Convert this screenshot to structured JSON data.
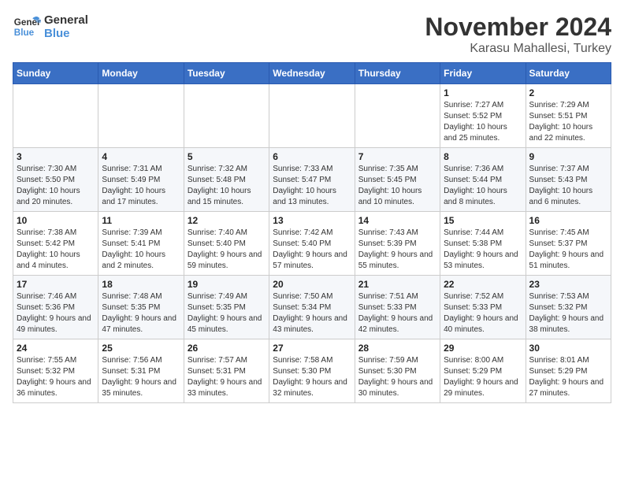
{
  "logo": {
    "line1": "General",
    "line2": "Blue"
  },
  "header": {
    "month": "November 2024",
    "location": "Karasu Mahallesi, Turkey"
  },
  "weekdays": [
    "Sunday",
    "Monday",
    "Tuesday",
    "Wednesday",
    "Thursday",
    "Friday",
    "Saturday"
  ],
  "weeks": [
    [
      {
        "day": "",
        "info": ""
      },
      {
        "day": "",
        "info": ""
      },
      {
        "day": "",
        "info": ""
      },
      {
        "day": "",
        "info": ""
      },
      {
        "day": "",
        "info": ""
      },
      {
        "day": "1",
        "info": "Sunrise: 7:27 AM\nSunset: 5:52 PM\nDaylight: 10 hours and 25 minutes."
      },
      {
        "day": "2",
        "info": "Sunrise: 7:29 AM\nSunset: 5:51 PM\nDaylight: 10 hours and 22 minutes."
      }
    ],
    [
      {
        "day": "3",
        "info": "Sunrise: 7:30 AM\nSunset: 5:50 PM\nDaylight: 10 hours and 20 minutes."
      },
      {
        "day": "4",
        "info": "Sunrise: 7:31 AM\nSunset: 5:49 PM\nDaylight: 10 hours and 17 minutes."
      },
      {
        "day": "5",
        "info": "Sunrise: 7:32 AM\nSunset: 5:48 PM\nDaylight: 10 hours and 15 minutes."
      },
      {
        "day": "6",
        "info": "Sunrise: 7:33 AM\nSunset: 5:47 PM\nDaylight: 10 hours and 13 minutes."
      },
      {
        "day": "7",
        "info": "Sunrise: 7:35 AM\nSunset: 5:45 PM\nDaylight: 10 hours and 10 minutes."
      },
      {
        "day": "8",
        "info": "Sunrise: 7:36 AM\nSunset: 5:44 PM\nDaylight: 10 hours and 8 minutes."
      },
      {
        "day": "9",
        "info": "Sunrise: 7:37 AM\nSunset: 5:43 PM\nDaylight: 10 hours and 6 minutes."
      }
    ],
    [
      {
        "day": "10",
        "info": "Sunrise: 7:38 AM\nSunset: 5:42 PM\nDaylight: 10 hours and 4 minutes."
      },
      {
        "day": "11",
        "info": "Sunrise: 7:39 AM\nSunset: 5:41 PM\nDaylight: 10 hours and 2 minutes."
      },
      {
        "day": "12",
        "info": "Sunrise: 7:40 AM\nSunset: 5:40 PM\nDaylight: 9 hours and 59 minutes."
      },
      {
        "day": "13",
        "info": "Sunrise: 7:42 AM\nSunset: 5:40 PM\nDaylight: 9 hours and 57 minutes."
      },
      {
        "day": "14",
        "info": "Sunrise: 7:43 AM\nSunset: 5:39 PM\nDaylight: 9 hours and 55 minutes."
      },
      {
        "day": "15",
        "info": "Sunrise: 7:44 AM\nSunset: 5:38 PM\nDaylight: 9 hours and 53 minutes."
      },
      {
        "day": "16",
        "info": "Sunrise: 7:45 AM\nSunset: 5:37 PM\nDaylight: 9 hours and 51 minutes."
      }
    ],
    [
      {
        "day": "17",
        "info": "Sunrise: 7:46 AM\nSunset: 5:36 PM\nDaylight: 9 hours and 49 minutes."
      },
      {
        "day": "18",
        "info": "Sunrise: 7:48 AM\nSunset: 5:35 PM\nDaylight: 9 hours and 47 minutes."
      },
      {
        "day": "19",
        "info": "Sunrise: 7:49 AM\nSunset: 5:35 PM\nDaylight: 9 hours and 45 minutes."
      },
      {
        "day": "20",
        "info": "Sunrise: 7:50 AM\nSunset: 5:34 PM\nDaylight: 9 hours and 43 minutes."
      },
      {
        "day": "21",
        "info": "Sunrise: 7:51 AM\nSunset: 5:33 PM\nDaylight: 9 hours and 42 minutes."
      },
      {
        "day": "22",
        "info": "Sunrise: 7:52 AM\nSunset: 5:33 PM\nDaylight: 9 hours and 40 minutes."
      },
      {
        "day": "23",
        "info": "Sunrise: 7:53 AM\nSunset: 5:32 PM\nDaylight: 9 hours and 38 minutes."
      }
    ],
    [
      {
        "day": "24",
        "info": "Sunrise: 7:55 AM\nSunset: 5:32 PM\nDaylight: 9 hours and 36 minutes."
      },
      {
        "day": "25",
        "info": "Sunrise: 7:56 AM\nSunset: 5:31 PM\nDaylight: 9 hours and 35 minutes."
      },
      {
        "day": "26",
        "info": "Sunrise: 7:57 AM\nSunset: 5:31 PM\nDaylight: 9 hours and 33 minutes."
      },
      {
        "day": "27",
        "info": "Sunrise: 7:58 AM\nSunset: 5:30 PM\nDaylight: 9 hours and 32 minutes."
      },
      {
        "day": "28",
        "info": "Sunrise: 7:59 AM\nSunset: 5:30 PM\nDaylight: 9 hours and 30 minutes."
      },
      {
        "day": "29",
        "info": "Sunrise: 8:00 AM\nSunset: 5:29 PM\nDaylight: 9 hours and 29 minutes."
      },
      {
        "day": "30",
        "info": "Sunrise: 8:01 AM\nSunset: 5:29 PM\nDaylight: 9 hours and 27 minutes."
      }
    ]
  ]
}
